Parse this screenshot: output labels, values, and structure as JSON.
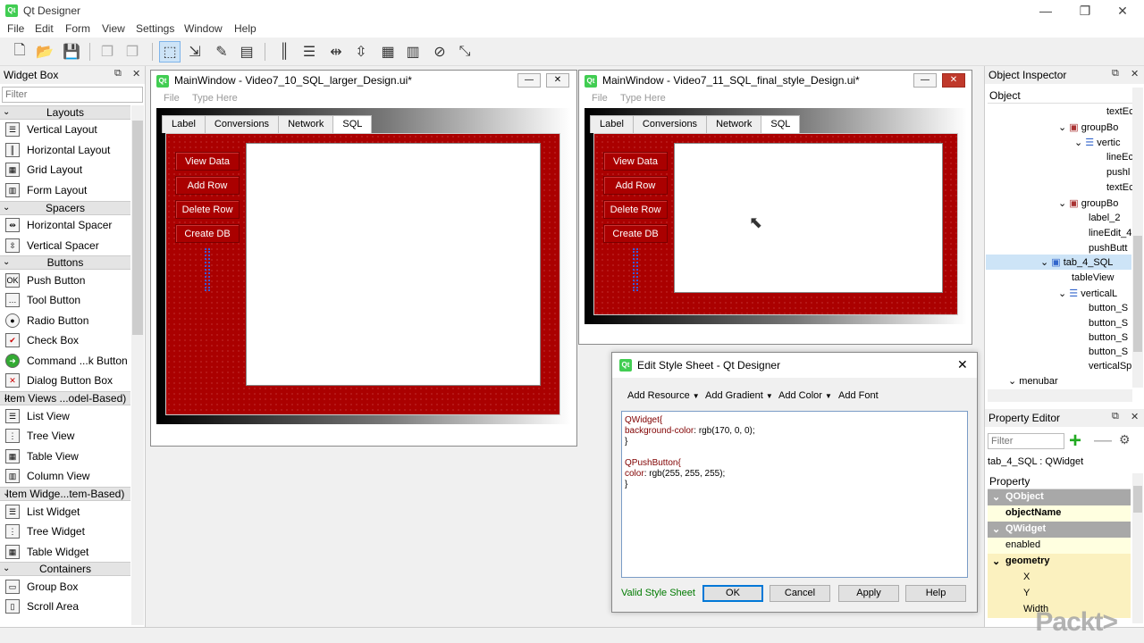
{
  "app": {
    "title": "Qt Designer",
    "menu": [
      "File",
      "Edit",
      "Form",
      "View",
      "Settings",
      "Window",
      "Help"
    ],
    "window_controls": [
      "—",
      "❐",
      "✕"
    ],
    "icon_text": "Qt"
  },
  "widget_box": {
    "title": "Widget Box",
    "filter_placeholder": "Filter",
    "sections": [
      {
        "label": "Layouts",
        "items": [
          "Vertical Layout",
          "Horizontal Layout",
          "Grid Layout",
          "Form Layout"
        ]
      },
      {
        "label": "Spacers",
        "items": [
          "Horizontal Spacer",
          "Vertical Spacer"
        ]
      },
      {
        "label": "Buttons",
        "items": [
          "Push Button",
          "Tool Button",
          "Radio Button",
          "Check Box",
          "Command ...k Button",
          "Dialog Button Box"
        ]
      },
      {
        "label": "Item Views ...odel-Based)",
        "items": [
          "List View",
          "Tree View",
          "Table View",
          "Column View"
        ]
      },
      {
        "label": "Item Widge...tem-Based)",
        "items": [
          "List Widget",
          "Tree Widget",
          "Table Widget"
        ]
      },
      {
        "label": "Containers",
        "items": [
          "Group Box",
          "Scroll Area"
        ]
      }
    ]
  },
  "form1": {
    "title": "MainWindow - Video7_10_SQL_larger_Design.ui*",
    "menu_file": "File",
    "menu_type": "Type Here",
    "tabs": [
      "Label",
      "Conversions",
      "Network",
      "SQL"
    ],
    "buttons": [
      "View Data",
      "Add Row",
      "Delete Row",
      "Create DB"
    ]
  },
  "form2": {
    "title": "MainWindow - Video7_11_SQL_final_style_Design.ui*",
    "menu_file": "File",
    "menu_type": "Type Here",
    "tabs": [
      "Label",
      "Conversions",
      "Network",
      "SQL"
    ],
    "buttons": [
      "View Data",
      "Add Row",
      "Delete Row",
      "Create DB"
    ]
  },
  "dialog": {
    "title": "Edit Style Sheet - Qt Designer",
    "menus": [
      "Add Resource",
      "Add Gradient",
      "Add Color",
      "Add Font"
    ],
    "code": {
      "l1_sel": "QWidget{",
      "l2_prop": "background-color",
      "l2_val": ": rgb(170, 0, 0);",
      "l3": "}",
      "l4_sel": "QPushButton{",
      "l5_prop": "color",
      "l5_val": ": rgb(255, 255, 255);",
      "l6": "}"
    },
    "status": "Valid Style Sheet",
    "buttons": {
      "ok": "OK",
      "cancel": "Cancel",
      "apply": "Apply",
      "help": "Help"
    }
  },
  "object_inspector": {
    "title": "Object Inspector",
    "header": "Object",
    "rows": [
      "textEc",
      "groupBo",
      "vertic",
      "lineEc",
      "pushl",
      "textEc",
      "groupBo",
      "label_2",
      "lineEdit_4",
      "pushButt",
      "tab_4_SQL",
      "tableView",
      "verticalL",
      "button_S",
      "button_S",
      "button_S",
      "button_S",
      "verticalSp",
      "menubar"
    ]
  },
  "property_editor": {
    "title": "Property Editor",
    "filter_placeholder": "Filter",
    "context": "tab_4_SQL : QWidget",
    "header": "Property",
    "rows": [
      "QObject",
      "objectName",
      "QWidget",
      "enabled",
      "geometry",
      "X",
      "Y",
      "Width"
    ]
  },
  "watermark": "Packt>"
}
